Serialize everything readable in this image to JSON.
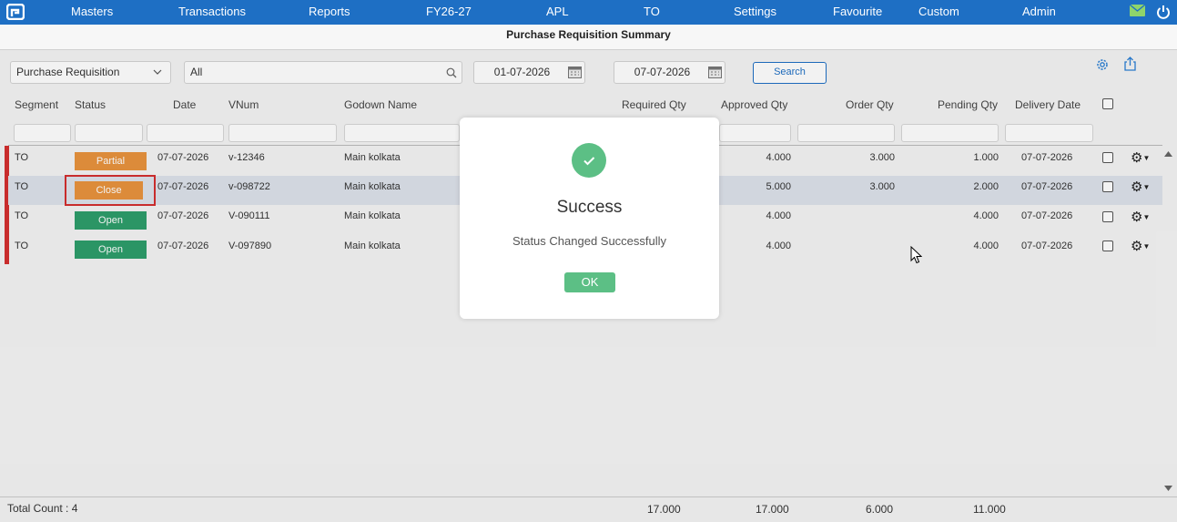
{
  "nav": {
    "items": [
      "Masters",
      "Transactions",
      "Reports",
      "FY26-27",
      "APL",
      "TO",
      "Settings",
      "Favourite",
      "Custom",
      "Admin"
    ]
  },
  "page": {
    "title": "Purchase Requisition Summary"
  },
  "filters": {
    "type_select": "Purchase Requisition",
    "search_value": "All",
    "from_date": "01-07-2026",
    "to_date": "07-07-2026",
    "search_button": "Search"
  },
  "table": {
    "headers": {
      "segment": "Segment",
      "status": "Status",
      "date": "Date",
      "vnum": "VNum",
      "godown": "Godown Name",
      "required": "Required Qty",
      "approved": "Approved Qty",
      "order": "Order Qty",
      "pending": "Pending Qty",
      "delivery": "Delivery Date"
    },
    "rows": [
      {
        "segment": "TO",
        "status": "Partial",
        "date": "07-07-2026",
        "vnum": "v-12346",
        "godown": "Main kolkata",
        "approved": "4.000",
        "order": "3.000",
        "pending": "1.000",
        "delivery": "07-07-2026"
      },
      {
        "segment": "TO",
        "status": "Close",
        "date": "07-07-2026",
        "vnum": "v-098722",
        "godown": "Main kolkata",
        "approved": "5.000",
        "order": "3.000",
        "pending": "2.000",
        "delivery": "07-07-2026"
      },
      {
        "segment": "TO",
        "status": "Open",
        "date": "07-07-2026",
        "vnum": "V-090111",
        "godown": "Main kolkata",
        "approved": "4.000",
        "order": "",
        "pending": "4.000",
        "delivery": "07-07-2026"
      },
      {
        "segment": "TO",
        "status": "Open",
        "date": "07-07-2026",
        "vnum": "V-097890",
        "godown": "Main kolkata",
        "approved": "4.000",
        "order": "",
        "pending": "4.000",
        "delivery": "07-07-2026"
      }
    ]
  },
  "footer": {
    "total_count": "Total Count : 4",
    "required_total": "17.000",
    "approved_total": "17.000",
    "order_total": "6.000",
    "pending_total": "11.000"
  },
  "modal": {
    "title": "Success",
    "message": "Status Changed Successfully",
    "ok": "OK"
  },
  "colors": {
    "nav": "#1e6fc4",
    "partial": "#e8933e",
    "close": "#e8933e",
    "open": "#2e9e6b",
    "success": "#5cbf85",
    "highlight": "#d32f2f"
  }
}
